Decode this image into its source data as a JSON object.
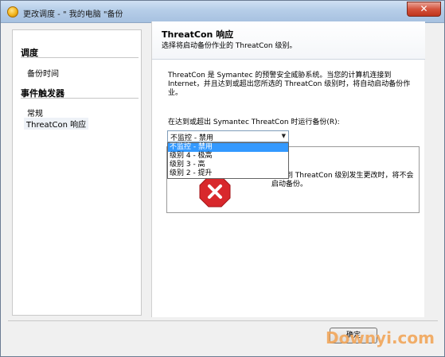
{
  "window": {
    "title": "更改调度 - \" 我的电脑 \"备份",
    "close_label": "✕"
  },
  "sidebar": {
    "sections": [
      {
        "heading": "调度",
        "items": [
          {
            "label": "备份时间"
          }
        ]
      },
      {
        "heading": "事件触发器",
        "items": [
          {
            "label": "常规"
          },
          {
            "label": "ThreatCon 响应"
          }
        ]
      }
    ]
  },
  "main": {
    "title": "ThreatCon 响应",
    "subtitle": "选择将启动备份作业的 ThreatCon 级别。",
    "description": "ThreatCon 是 Symantec 的预警安全威胁系统。当您的计算机连接到 Internet，并且达到或超出您所选的 ThreatCon 级别时，将自动启动备份作业。",
    "level_label": "在达到或超出 Symantec ThreatCon 时运行备份(R):",
    "level_select": {
      "value": "不监控 - 禁用",
      "options": [
        "不监控 - 禁用",
        "级别 4 - 极高",
        "级别 3 - 高",
        "级别 2 - 提升"
      ],
      "highlighted_index": 0
    },
    "info_text": "检测到 ThreatCon 级别发生更改时，将不会启动备份。"
  },
  "footer": {
    "ok_label": "确定"
  },
  "watermark": "Downyi.com",
  "icons": {
    "app": "backup-app-icon",
    "stop": "stop-icon"
  },
  "colors": {
    "selection": "#3399ff",
    "stop_icon": "#d8282c",
    "watermark": "#f2a65a"
  }
}
